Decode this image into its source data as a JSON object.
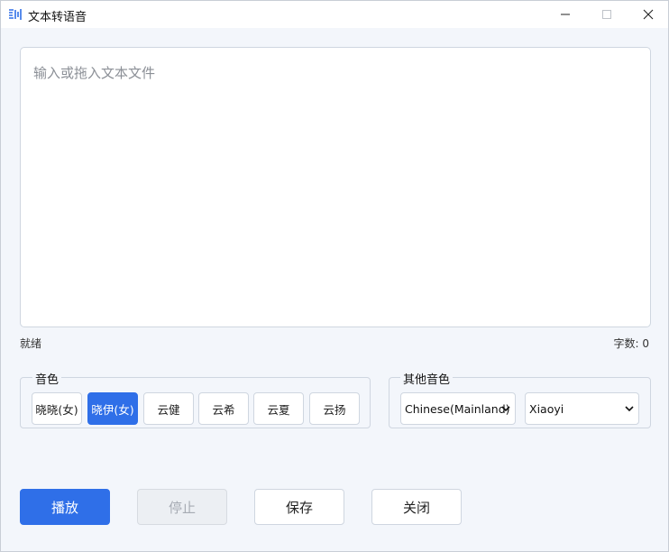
{
  "window": {
    "title": "文本转语音",
    "icon": "sound-wave-icon"
  },
  "editor": {
    "placeholder": "输入或拖入文本文件",
    "value": ""
  },
  "status": {
    "state": "就绪",
    "char_count": "字数: 0"
  },
  "voice_group": {
    "legend": "音色",
    "voices": [
      {
        "label": "晓晓(女)",
        "selected": false
      },
      {
        "label": "晓伊(女)",
        "selected": true
      },
      {
        "label": "云健",
        "selected": false
      },
      {
        "label": "云希",
        "selected": false
      },
      {
        "label": "云夏",
        "selected": false
      },
      {
        "label": "云扬",
        "selected": false
      }
    ]
  },
  "other_group": {
    "legend": "其他音色",
    "language": "Chinese(Mainland)",
    "voice": "Xiaoyi"
  },
  "actions": {
    "play": "播放",
    "stop": "停止",
    "save": "保存",
    "close": "关闭"
  },
  "colors": {
    "accent": "#2f6fe8",
    "background": "#f3f6fb",
    "disabled": "#eceff3"
  }
}
